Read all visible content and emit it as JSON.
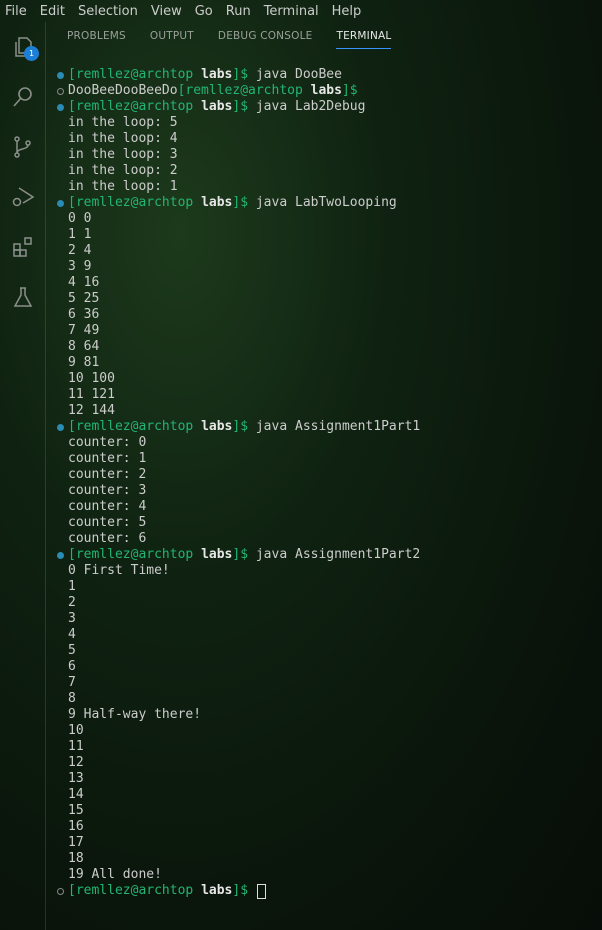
{
  "menu": [
    "File",
    "Edit",
    "Selection",
    "View",
    "Go",
    "Run",
    "Terminal",
    "Help"
  ],
  "activity": {
    "explorer_badge": "1",
    "icons": [
      "files-icon",
      "search-icon",
      "source-control-icon",
      "run-debug-icon",
      "extensions-icon",
      "testing-icon"
    ]
  },
  "panel_tabs": [
    {
      "label": "PROBLEMS"
    },
    {
      "label": "OUTPUT"
    },
    {
      "label": "DEBUG CONSOLE"
    },
    {
      "label": "TERMINAL",
      "active": true
    }
  ],
  "prompt": {
    "user": "[remllez@archtop ",
    "dir": "labs",
    "end": "]$"
  },
  "colors": {
    "prompt": "#23b573",
    "dot": "#2a8bb5",
    "tab_underline": "#3794ff"
  },
  "lines": [
    {
      "mark": "dot",
      "prompt": true,
      "text": " java DooBee"
    },
    {
      "mark": "ring",
      "pre": "DooBeeDooBeeDo",
      "prompt": true,
      "text": ""
    },
    {
      "mark": "dot",
      "prompt": true,
      "text": " java Lab2Debug"
    },
    {
      "text": "in the loop: 5"
    },
    {
      "text": "in the loop: 4"
    },
    {
      "text": "in the loop: 3"
    },
    {
      "text": "in the loop: 2"
    },
    {
      "text": "in the loop: 1"
    },
    {
      "mark": "dot",
      "prompt": true,
      "text": " java LabTwoLooping"
    },
    {
      "text": "0 0"
    },
    {
      "text": "1 1"
    },
    {
      "text": "2 4"
    },
    {
      "text": "3 9"
    },
    {
      "text": "4 16"
    },
    {
      "text": "5 25"
    },
    {
      "text": "6 36"
    },
    {
      "text": "7 49"
    },
    {
      "text": "8 64"
    },
    {
      "text": "9 81"
    },
    {
      "text": "10 100"
    },
    {
      "text": "11 121"
    },
    {
      "text": "12 144"
    },
    {
      "mark": "dot",
      "prompt": true,
      "text": " java Assignment1Part1"
    },
    {
      "text": "counter: 0"
    },
    {
      "text": "counter: 1"
    },
    {
      "text": "counter: 2"
    },
    {
      "text": "counter: 3"
    },
    {
      "text": "counter: 4"
    },
    {
      "text": "counter: 5"
    },
    {
      "text": "counter: 6"
    },
    {
      "mark": "dot",
      "prompt": true,
      "text": " java Assignment1Part2"
    },
    {
      "text": "0 First Time!"
    },
    {
      "text": "1"
    },
    {
      "text": "2"
    },
    {
      "text": "3"
    },
    {
      "text": "4"
    },
    {
      "text": "5"
    },
    {
      "text": "6"
    },
    {
      "text": "7"
    },
    {
      "text": "8"
    },
    {
      "text": "9 Half-way there!"
    },
    {
      "text": "10"
    },
    {
      "text": "11"
    },
    {
      "text": "12"
    },
    {
      "text": "13"
    },
    {
      "text": "14"
    },
    {
      "text": "15"
    },
    {
      "text": "16"
    },
    {
      "text": "17"
    },
    {
      "text": "18"
    },
    {
      "text": "19 All done!"
    },
    {
      "mark": "ring",
      "prompt": true,
      "text": " ",
      "cursor": true
    }
  ]
}
